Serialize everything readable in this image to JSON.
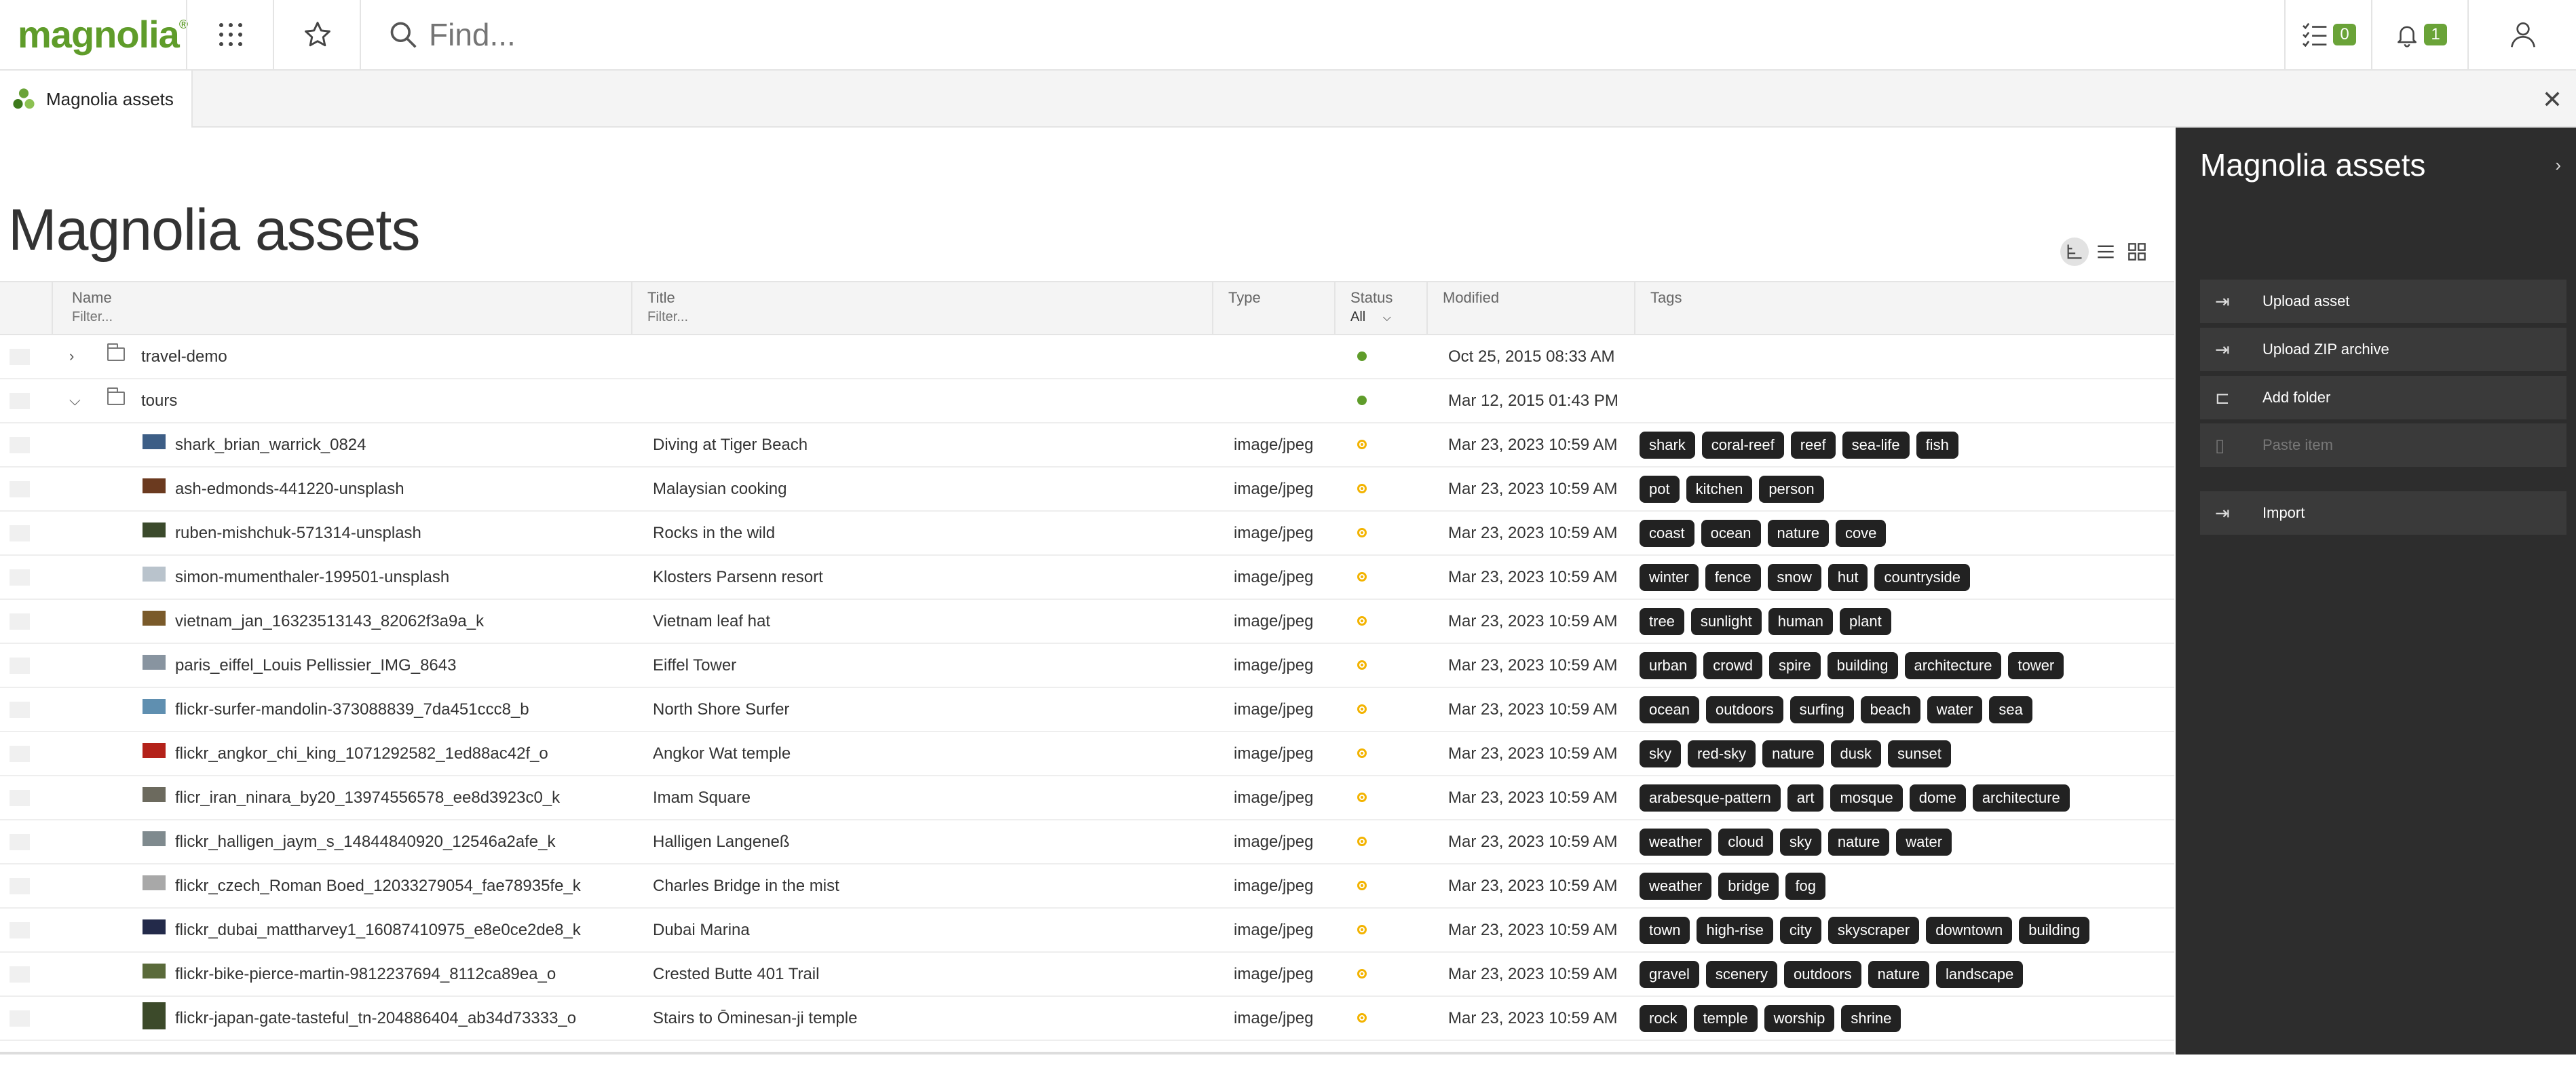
{
  "topbar": {
    "logo": "magnolia",
    "logo_mark": "®",
    "search_placeholder": "Find...",
    "tasks_count": "0",
    "notifications_count": "1"
  },
  "app_tab": {
    "label": "Magnolia assets"
  },
  "page_title": "Magnolia assets",
  "grid": {
    "headers": {
      "name": "Name",
      "name_filter": "Filter...",
      "title": "Title",
      "title_filter": "Filter...",
      "type": "Type",
      "status": "Status",
      "status_filter": "All",
      "modified": "Modified",
      "tags": "Tags"
    },
    "rows": [
      {
        "kind": "folder",
        "expanded": false,
        "name": "travel-demo",
        "title": "",
        "type": "",
        "status": "published",
        "modified": "Oct 25, 2015 08:33 AM",
        "tags": []
      },
      {
        "kind": "folder",
        "expanded": true,
        "name": "tours",
        "title": "",
        "type": "",
        "status": "published",
        "modified": "Mar 12, 2015 01:43 PM",
        "tags": []
      },
      {
        "kind": "asset",
        "name": "shark_brian_warrick_0824",
        "title": "Diving at Tiger Beach",
        "type": "image/jpeg",
        "status": "modified",
        "modified": "Mar 23, 2023 10:59 AM",
        "tags": [
          "shark",
          "coral-reef",
          "reef",
          "sea-life",
          "fish"
        ],
        "thumb": "#3d5e86"
      },
      {
        "kind": "asset",
        "name": "ash-edmonds-441220-unsplash",
        "title": "Malaysian cooking",
        "type": "image/jpeg",
        "status": "modified",
        "modified": "Mar 23, 2023 10:59 AM",
        "tags": [
          "pot",
          "kitchen",
          "person"
        ],
        "thumb": "#6b3a1f"
      },
      {
        "kind": "asset",
        "name": "ruben-mishchuk-571314-unsplash",
        "title": "Rocks in the wild",
        "type": "image/jpeg",
        "status": "modified",
        "modified": "Mar 23, 2023 10:59 AM",
        "tags": [
          "coast",
          "ocean",
          "nature",
          "cove"
        ],
        "thumb": "#3b4a2c"
      },
      {
        "kind": "asset",
        "name": "simon-mumenthaler-199501-unsplash",
        "title": "Klosters Parsenn resort",
        "type": "image/jpeg",
        "status": "modified",
        "modified": "Mar 23, 2023 10:59 AM",
        "tags": [
          "winter",
          "fence",
          "snow",
          "hut",
          "countryside"
        ],
        "thumb": "#b9c3cc"
      },
      {
        "kind": "asset",
        "name": "vietnam_jan_16323513143_82062f3a9a_k",
        "title": "Vietnam leaf hat",
        "type": "image/jpeg",
        "status": "modified",
        "modified": "Mar 23, 2023 10:59 AM",
        "tags": [
          "tree",
          "sunlight",
          "human",
          "plant"
        ],
        "thumb": "#7a5a2a"
      },
      {
        "kind": "asset",
        "name": "paris_eiffel_Louis Pellissier_IMG_8643",
        "title": "Eiffel Tower",
        "type": "image/jpeg",
        "status": "modified",
        "modified": "Mar 23, 2023 10:59 AM",
        "tags": [
          "urban",
          "crowd",
          "spire",
          "building",
          "architecture",
          "tower"
        ],
        "thumb": "#8894a0"
      },
      {
        "kind": "asset",
        "name": "flickr-surfer-mandolin-373088839_7da451ccc8_b",
        "title": "North Shore Surfer",
        "type": "image/jpeg",
        "status": "modified",
        "modified": "Mar 23, 2023 10:59 AM",
        "tags": [
          "ocean",
          "outdoors",
          "surfing",
          "beach",
          "water",
          "sea"
        ],
        "thumb": "#5f8fb0"
      },
      {
        "kind": "asset",
        "name": "flickr_angkor_chi_king_1071292582_1ed88ac42f_o",
        "title": "Angkor Wat temple",
        "type": "image/jpeg",
        "status": "modified",
        "modified": "Mar 23, 2023 10:59 AM",
        "tags": [
          "sky",
          "red-sky",
          "nature",
          "dusk",
          "sunset"
        ],
        "thumb": "#b4221a"
      },
      {
        "kind": "asset",
        "name": "flicr_iran_ninara_by20_13974556578_ee8d3923c0_k",
        "title": "Imam Square",
        "type": "image/jpeg",
        "status": "modified",
        "modified": "Mar 23, 2023 10:59 AM",
        "tags": [
          "arabesque-pattern",
          "art",
          "mosque",
          "dome",
          "architecture"
        ],
        "thumb": "#6c6a5e"
      },
      {
        "kind": "asset",
        "name": "flickr_halligen_jaym_s_14844840920_12546a2afe_k",
        "title": "Halligen Langeneß",
        "type": "image/jpeg",
        "status": "modified",
        "modified": "Mar 23, 2023 10:59 AM",
        "tags": [
          "weather",
          "cloud",
          "sky",
          "nature",
          "water"
        ],
        "thumb": "#7f8a8e"
      },
      {
        "kind": "asset",
        "name": "flickr_czech_Roman Boed_12033279054_fae78935fe_k",
        "title": "Charles Bridge in the mist",
        "type": "image/jpeg",
        "status": "modified",
        "modified": "Mar 23, 2023 10:59 AM",
        "tags": [
          "weather",
          "bridge",
          "fog"
        ],
        "thumb": "#a8a8a8"
      },
      {
        "kind": "asset",
        "name": "flickr_dubai_mattharvey1_16087410975_e8e0ce2de8_k",
        "title": "Dubai Marina",
        "type": "image/jpeg",
        "status": "modified",
        "modified": "Mar 23, 2023 10:59 AM",
        "tags": [
          "town",
          "high-rise",
          "city",
          "skyscraper",
          "downtown",
          "building"
        ],
        "thumb": "#232a4a"
      },
      {
        "kind": "asset",
        "name": "flickr-bike-pierce-martin-9812237694_8112ca89ea_o",
        "title": "Crested Butte 401 Trail",
        "type": "image/jpeg",
        "status": "modified",
        "modified": "Mar 23, 2023 10:59 AM",
        "tags": [
          "gravel",
          "scenery",
          "outdoors",
          "nature",
          "landscape"
        ],
        "thumb": "#5a6a3a"
      },
      {
        "kind": "asset",
        "name": "flickr-japan-gate-tasteful_tn-204886404_ab34d73333_o",
        "title": "Stairs to Ōminesan-ji temple",
        "type": "image/jpeg",
        "status": "modified",
        "modified": "Mar 23, 2023 10:59 AM",
        "tags": [
          "rock",
          "temple",
          "worship",
          "shrine"
        ],
        "thumb": "#3c4a2a",
        "tall": true
      }
    ]
  },
  "actionbar": {
    "title": "Magnolia assets",
    "items": [
      {
        "label": "Upload asset",
        "icon": "upload-icon",
        "disabled": false
      },
      {
        "label": "Upload ZIP archive",
        "icon": "upload-zip-icon",
        "disabled": false
      },
      {
        "label": "Add folder",
        "icon": "add-folder-icon",
        "disabled": false
      },
      {
        "label": "Paste item",
        "icon": "paste-icon",
        "disabled": true
      },
      {
        "label": "Import",
        "icon": "import-icon",
        "disabled": false
      }
    ]
  },
  "colors": {
    "accent": "#5f9c2a",
    "badge": "#6aa338",
    "actionbar": "#2d2d2d",
    "tag": "#222222",
    "status_modified": "#f3b300"
  }
}
